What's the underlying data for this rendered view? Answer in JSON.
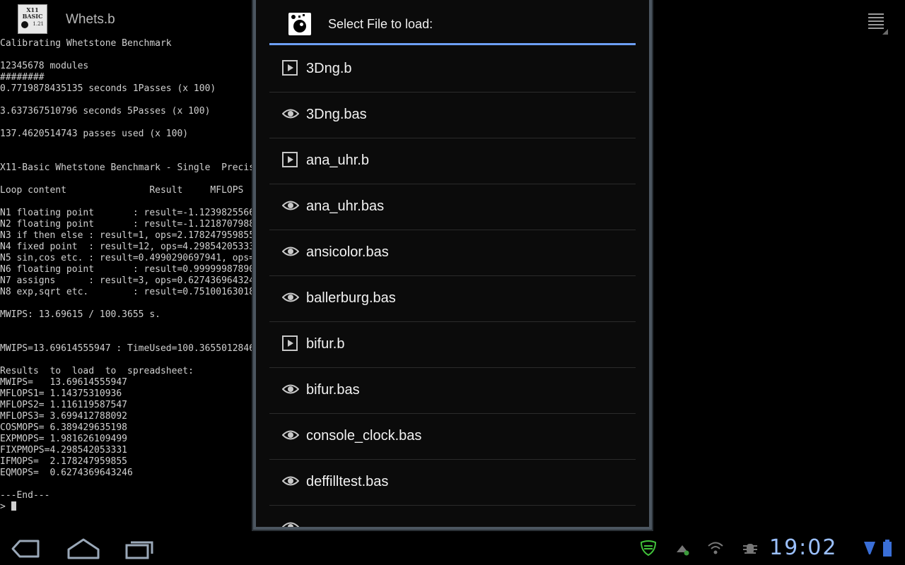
{
  "app": {
    "title": "Whets.b",
    "icon_name": "x11-basic-icon",
    "icon_text_line1": "X11",
    "icon_text_line2": "BASIC",
    "icon_version": "1.21"
  },
  "terminal": {
    "lines": [
      "Calibrating Whetstone Benchmark",
      "",
      "12345678 modules",
      "########",
      "0.7719878435135 seconds 1Passes (x 100)",
      "",
      "3.637367510796 seconds 5Passes (x 100)",
      "",
      "137.4620514743 passes used (x 100)",
      "",
      "",
      "X11-Basic Whetstone Benchmark - Single  Precis",
      "",
      "Loop content               Result     MFLOPS",
      "",
      "N1 floating point       : result=-1.1239825566",
      "N2 floating point       : result=-1.1218707988",
      "N3 if then else : result=1, ops=2.178247959855",
      "N4 fixed point  : result=12, ops=4.29854205333",
      "N5 sin,cos etc. : result=0.4990290697941, ops=",
      "N6 floating point       : result=0.99999987890",
      "N7 assigns      : result=3, ops=0.627436964324",
      "N8 exp,sqrt etc.        : result=0.75100163018",
      "",
      "MWIPS: 13.69615 / 100.3655 s.",
      "",
      "",
      "MWIPS=13.69614555947 : TimeUsed=100.3655012846",
      "",
      "Results  to  load  to  spreadsheet:",
      "MWIPS=   13.69614555947",
      "MFLOPS1= 1.14375310936",
      "MFLOPS2= 1.116119587547",
      "MFLOPS3= 3.699412788092",
      "COSMOPS= 6.389429635198",
      "EXPMOPS= 1.981626109499",
      "FIXPMOPS=4.298542053331",
      "IFMOPS=  2.178247959855",
      "EQMOPS=  0.6274369643246",
      "",
      "---End---"
    ],
    "prompt": ">"
  },
  "dialog": {
    "title": "Select File to load:",
    "accent_color": "#6d9ff5",
    "files": [
      {
        "name": "3Dng.b",
        "icon": "play-icon"
      },
      {
        "name": "3Dng.bas",
        "icon": "eye-icon"
      },
      {
        "name": "ana_uhr.b",
        "icon": "play-icon"
      },
      {
        "name": "ana_uhr.bas",
        "icon": "eye-icon"
      },
      {
        "name": "ansicolor.bas",
        "icon": "eye-icon"
      },
      {
        "name": "ballerburg.bas",
        "icon": "eye-icon"
      },
      {
        "name": "bifur.b",
        "icon": "play-icon"
      },
      {
        "name": "bifur.bas",
        "icon": "eye-icon"
      },
      {
        "name": "console_clock.bas",
        "icon": "eye-icon"
      },
      {
        "name": "deffilltest.bas",
        "icon": "eye-icon"
      },
      {
        "name": "",
        "icon": "eye-icon"
      }
    ]
  },
  "systembar": {
    "time": "19:02",
    "clock_color": "#9bc0ff",
    "nav_icons": [
      "back-icon",
      "home-icon",
      "recent-apps-icon"
    ],
    "status_icons": [
      "android-shield-icon",
      "usb-debug-icon",
      "wifi-icon",
      "bug-icon",
      "signal-icon",
      "battery-icon"
    ]
  }
}
